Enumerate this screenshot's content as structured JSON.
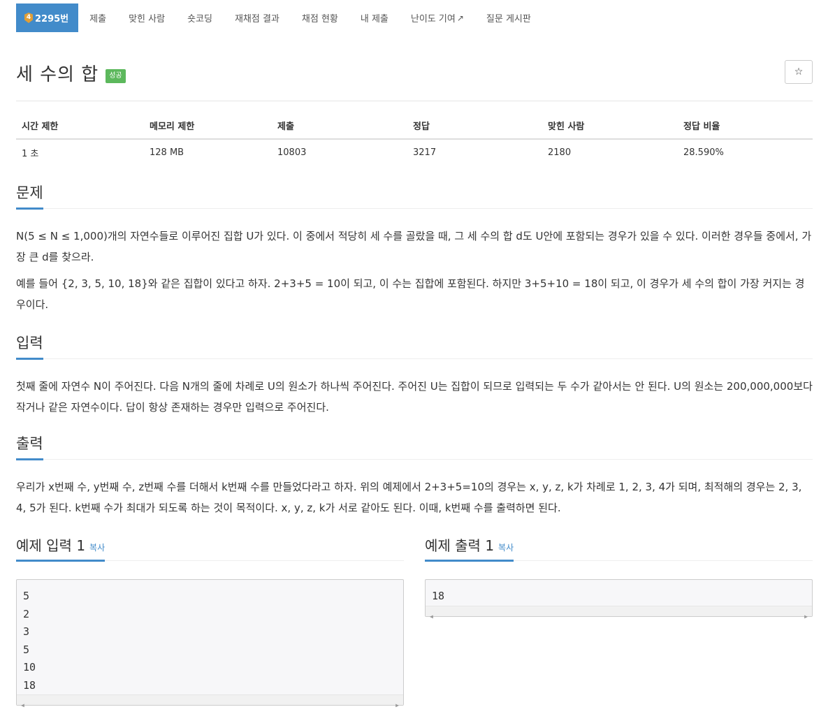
{
  "tabs": [
    {
      "label": "2295번",
      "active": true
    },
    {
      "label": "제출"
    },
    {
      "label": "맞힌 사람"
    },
    {
      "label": "숏코딩"
    },
    {
      "label": "재채점 결과"
    },
    {
      "label": "채점 현황"
    },
    {
      "label": "내 제출"
    },
    {
      "label": "난이도 기여"
    },
    {
      "label": "질문 게시판"
    }
  ],
  "tier_icon_text": "4",
  "title": "세 수의 합",
  "status_badge": "성공",
  "star_glyph": "☆",
  "info": {
    "headers": [
      "시간 제한",
      "메모리 제한",
      "제출",
      "정답",
      "맞힌 사람",
      "정답 비율"
    ],
    "values": [
      "1 초",
      "128 MB",
      "10803",
      "3217",
      "2180",
      "28.590%"
    ]
  },
  "problem": {
    "heading": "문제",
    "p1": "N(5 ≤ N ≤ 1,000)개의 자연수들로 이루어진 집합 U가 있다. 이 중에서 적당히 세 수를 골랐을 때, 그 세 수의 합 d도 U안에 포함되는 경우가 있을 수 있다. 이러한 경우들 중에서, 가장 큰 d를 찾으라.",
    "p2": "예를 들어 {2, 3, 5, 10, 18}와 같은 집합이 있다고 하자. 2+3+5 = 10이 되고, 이 수는 집합에 포함된다. 하지만 3+5+10 = 18이 되고, 이 경우가 세 수의 합이 가장 커지는 경우이다."
  },
  "input": {
    "heading": "입력",
    "p1": "첫째 줄에 자연수 N이 주어진다. 다음 N개의 줄에 차례로 U의 원소가 하나씩 주어진다. 주어진 U는 집합이 되므로 입력되는 두 수가 같아서는 안 된다. U의 원소는 200,000,000보다 작거나 같은 자연수이다. 답이 항상 존재하는 경우만 입력으로 주어진다."
  },
  "output": {
    "heading": "출력",
    "p1": "우리가 x번째 수, y번째 수, z번째 수를 더해서 k번째 수를 만들었다라고 하자. 위의 예제에서 2+3+5=10의 경우는 x, y, z, k가 차례로 1, 2, 3, 4가 되며, 최적해의 경우는 2, 3, 4, 5가 된다. k번째 수가 최대가 되도록 하는 것이 목적이다. x, y, z, k가 서로 같아도 된다. 이때, k번째 수를 출력하면 된다."
  },
  "sample_input": {
    "heading": "예제 입력 1",
    "copy": "복사",
    "content": "5\n2\n3\n5\n10\n18"
  },
  "sample_output": {
    "heading": "예제 출력 1",
    "copy": "복사",
    "content": "18"
  },
  "scroll_left": "◀",
  "scroll_right": "▶",
  "external_link_icon": "↗"
}
